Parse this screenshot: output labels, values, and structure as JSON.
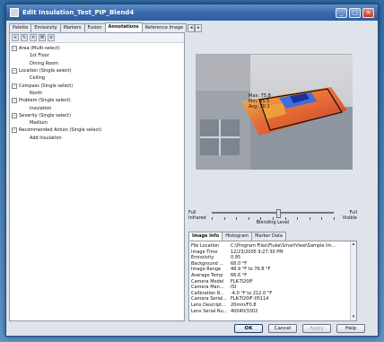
{
  "window": {
    "title": "Edit Insulation_Test_PIP_Blend4"
  },
  "tabs": [
    {
      "label": "Palette",
      "active": false
    },
    {
      "label": "Emissivity",
      "active": false
    },
    {
      "label": "Markers",
      "active": false
    },
    {
      "label": "Fusion",
      "active": false
    },
    {
      "label": "Annotations",
      "active": true
    },
    {
      "label": "Reference Image",
      "active": false
    }
  ],
  "tab_scroll": {
    "left": "◂",
    "right": "▸"
  },
  "toolbar": {
    "buttons": [
      "+",
      "✎",
      "✕",
      "⌘",
      "≡"
    ]
  },
  "tree": [
    {
      "label": "Area (Multi-select)",
      "level": 0,
      "expander": "−"
    },
    {
      "label": "1st Floor",
      "level": 1
    },
    {
      "label": "Dining Room",
      "level": 1
    },
    {
      "label": "Location (Single select)",
      "level": 0,
      "expander": "−"
    },
    {
      "label": "Ceiling",
      "level": 1
    },
    {
      "label": "Compass (Single select)",
      "level": 0,
      "expander": "−"
    },
    {
      "label": "North",
      "level": 1
    },
    {
      "label": "Problem (Single select)",
      "level": 0,
      "expander": "−"
    },
    {
      "label": "Insulation",
      "level": 1
    },
    {
      "label": "Severity (Single select)",
      "level": 0,
      "expander": "−"
    },
    {
      "label": "Medium",
      "level": 1
    },
    {
      "label": "Recommended Action (Single select)",
      "level": 0,
      "expander": "−"
    },
    {
      "label": "Add Insulation",
      "level": 1
    }
  ],
  "overlay": {
    "lines": [
      "Max: 75.8",
      "Min: 65.5",
      "Avg: 70.1"
    ],
    "colors": {
      "hot": "#e8462a",
      "warm": "#f2a33a",
      "cool": "#3d6ee0",
      "cold": "#1e2f9e"
    }
  },
  "blend": {
    "left_top": "Full",
    "left_bottom": "Infrared",
    "right_top": "Full",
    "right_bottom": "Visible",
    "label": "Blending Level",
    "level": 0.55
  },
  "info_tabs": [
    {
      "label": "Image Info",
      "active": true
    },
    {
      "label": "Histogram",
      "active": false
    },
    {
      "label": "Marker Data",
      "active": false
    }
  ],
  "info_rows": [
    {
      "key": "File Location",
      "value": "C:\\Program Files\\Fluke\\SmartView\\Sample Im..."
    },
    {
      "key": "Image Time",
      "value": "12/23/2005 9:27:30 PM"
    },
    {
      "key": "Emissivity",
      "value": "0.95"
    },
    {
      "key": "Background ...",
      "value": "68.0 °F"
    },
    {
      "key": "Image Range",
      "value": "48.9 °F to 76.8 °F"
    },
    {
      "key": "Average Temp",
      "value": "66.6 °F"
    },
    {
      "key": "Camera Model",
      "value": "FLK-Ti20IF"
    },
    {
      "key": "Camera Man...",
      "value": "ISI"
    },
    {
      "key": "Calibration R...",
      "value": "-4.0 °F to 212.0 °F"
    },
    {
      "key": "Camera Serial...",
      "value": "FLK-Ti20IF-05114"
    },
    {
      "key": "Lens Descript...",
      "value": "20mm/F0.8"
    },
    {
      "key": "Lens Serial Nu...",
      "value": "40040/3302"
    }
  ],
  "scroll": {
    "up": "▴",
    "down": "▾"
  },
  "buttons": {
    "ok": "OK",
    "cancel": "Cancel",
    "apply": "Apply",
    "help": "Help"
  },
  "title_buttons": {
    "min": "_",
    "max": "□",
    "close": "×"
  }
}
